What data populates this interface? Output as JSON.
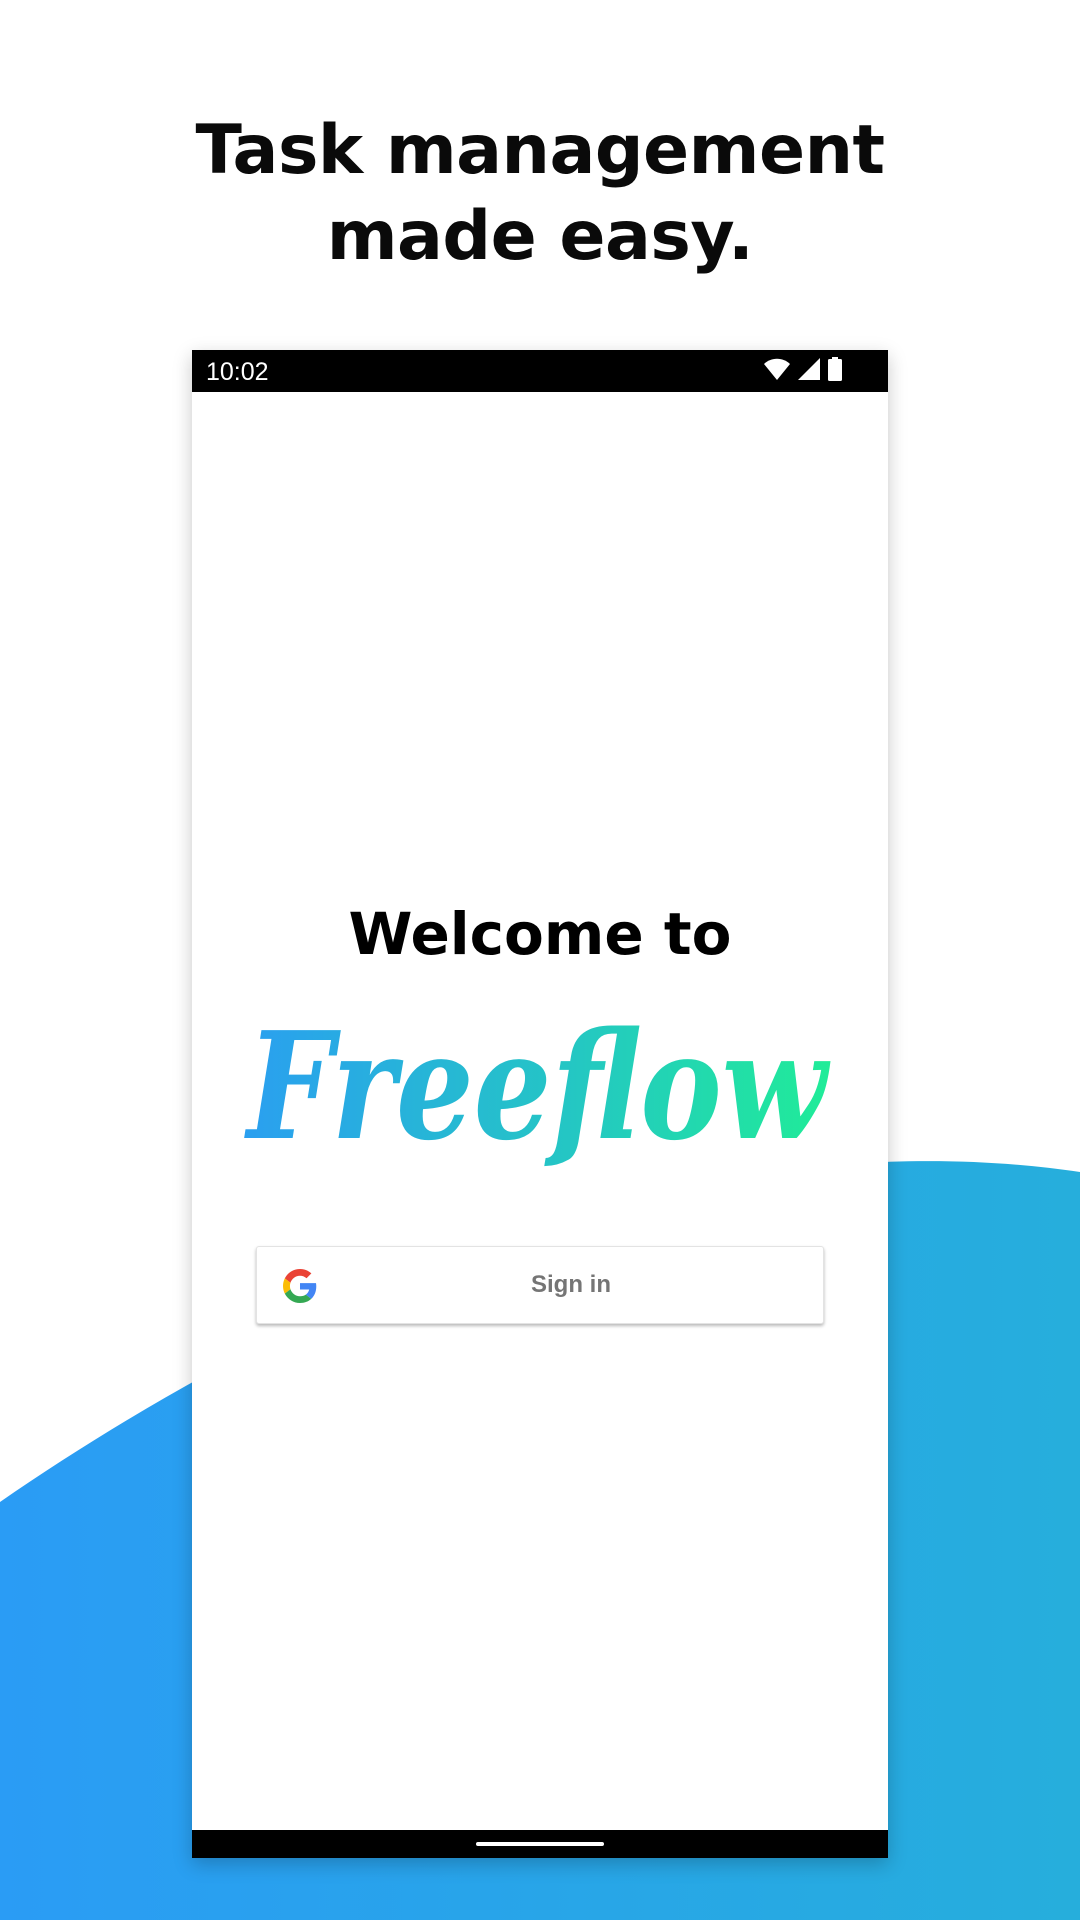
{
  "headline": {
    "line1": "Task management",
    "line2": "made easy."
  },
  "status_bar": {
    "time": "10:02",
    "icons": [
      "wifi-icon",
      "signal-icon",
      "battery-icon"
    ]
  },
  "welcome_text": "Welcome to",
  "logo": {
    "text": "Freeflow",
    "gradient_start": "#2a9ff0",
    "gradient_end": "#20ec98"
  },
  "signin_button": {
    "label": "Sign in",
    "icon": "google-icon"
  },
  "colors": {
    "wave_left": "#2a9cf5",
    "wave_right": "#26aedc",
    "status_bar": "#000000"
  }
}
